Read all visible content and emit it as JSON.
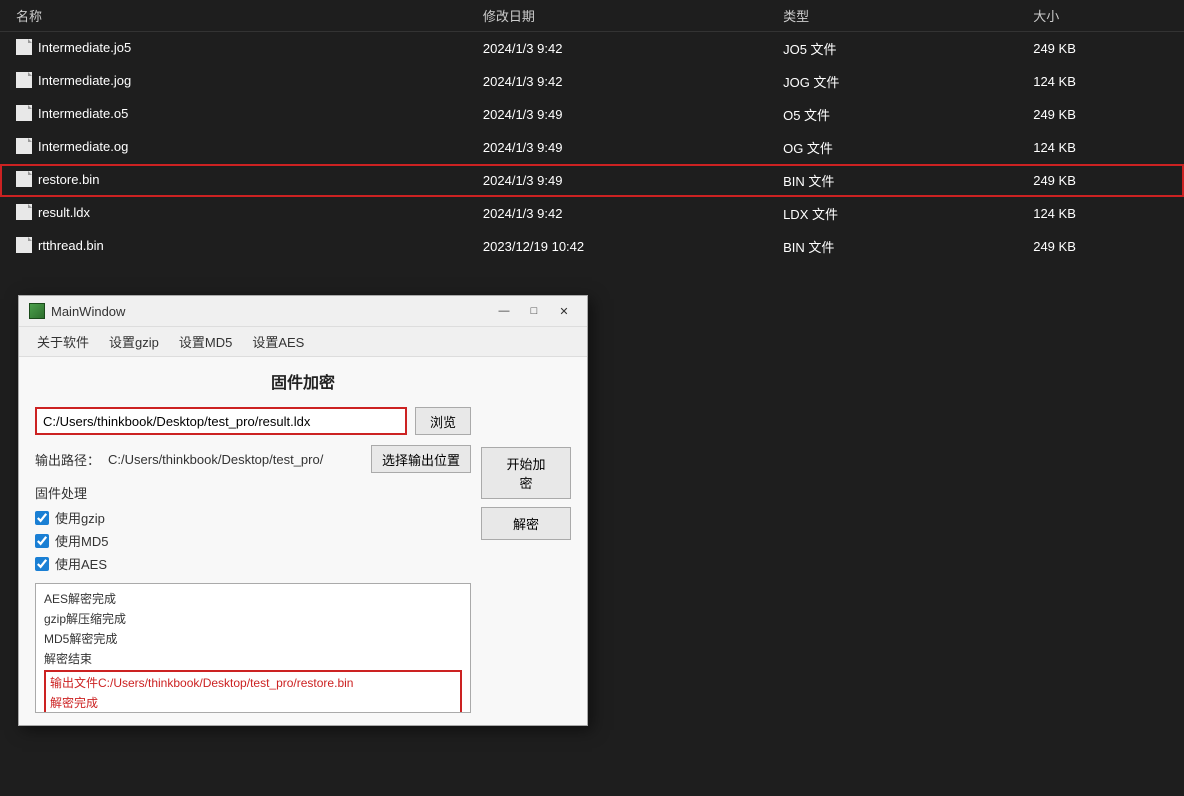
{
  "fileExplorer": {
    "columns": {
      "name": "名称",
      "date": "修改日期",
      "type": "类型",
      "size": "大小"
    },
    "files": [
      {
        "name": "Intermediate.jo5",
        "date": "2024/1/3 9:42",
        "type": "JO5 文件",
        "size": "249 KB",
        "highlighted": false
      },
      {
        "name": "Intermediate.jog",
        "date": "2024/1/3 9:42",
        "type": "JOG 文件",
        "size": "124 KB",
        "highlighted": false
      },
      {
        "name": "Intermediate.o5",
        "date": "2024/1/3 9:49",
        "type": "O5 文件",
        "size": "249 KB",
        "highlighted": false
      },
      {
        "name": "Intermediate.og",
        "date": "2024/1/3 9:49",
        "type": "OG 文件",
        "size": "124 KB",
        "highlighted": false
      },
      {
        "name": "restore.bin",
        "date": "2024/1/3 9:49",
        "type": "BIN 文件",
        "size": "249 KB",
        "highlighted": true
      },
      {
        "name": "result.ldx",
        "date": "2024/1/3 9:42",
        "type": "LDX 文件",
        "size": "124 KB",
        "highlighted": false
      },
      {
        "name": "rtthread.bin",
        "date": "2023/12/19 10:42",
        "type": "BIN 文件",
        "size": "249 KB",
        "highlighted": false
      }
    ]
  },
  "mainWindow": {
    "title": "MainWindow",
    "menus": [
      "关于软件",
      "设置gzip",
      "设置MD5",
      "设置AES"
    ],
    "heading": "固件加密",
    "fileInputValue": "C:/Users/thinkbook/Desktop/test_pro/result.ldx",
    "fileInputHighlighted": true,
    "browseBtnLabel": "浏览",
    "outputLabel": "输出路径：",
    "outputPath": "C:/Users/thinkbook/Desktop/test_pro/",
    "selectOutputBtnLabel": "选择输出位置",
    "firmwareSectionLabel": "固件处理",
    "checkboxes": [
      {
        "label": "使用gzip",
        "checked": true
      },
      {
        "label": "使用MD5",
        "checked": true
      },
      {
        "label": "使用AES",
        "checked": true
      }
    ],
    "startEncryptBtnLabel": "开始加密",
    "decryptBtnLabel": "解密",
    "logLines": [
      {
        "text": "AES解密完成",
        "highlighted": false
      },
      {
        "text": "gzip解压缩完成",
        "highlighted": false
      },
      {
        "text": "MD5解密完成",
        "highlighted": false
      },
      {
        "text": "解密结束",
        "highlighted": false
      },
      {
        "text": "输出文件C:/Users/thinkbook/Desktop/test_pro/restore.bin",
        "highlighted": true
      },
      {
        "text": "解密完成",
        "highlighted": true
      }
    ]
  },
  "icons": {
    "file": "📄",
    "minimize": "—",
    "maximize": "□",
    "close": "✕",
    "windowIcon": "■"
  }
}
